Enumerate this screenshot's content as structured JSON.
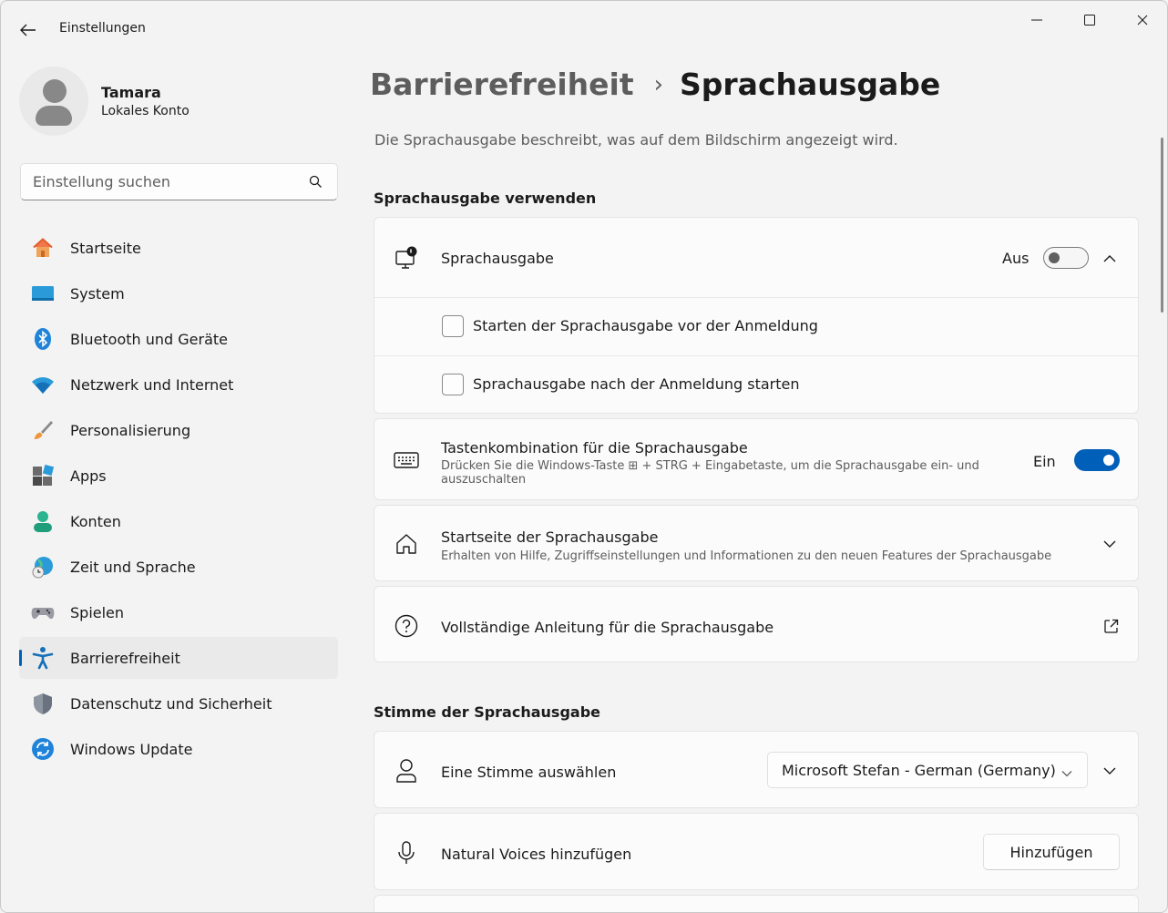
{
  "window": {
    "title": "Einstellungen"
  },
  "profile": {
    "name": "Tamara",
    "account_type": "Lokales Konto"
  },
  "search": {
    "placeholder": "Einstellung suchen"
  },
  "sidebar": {
    "items": [
      {
        "label": "Startseite",
        "icon": "home-icon"
      },
      {
        "label": "System",
        "icon": "system-icon"
      },
      {
        "label": "Bluetooth und Geräte",
        "icon": "bluetooth-icon"
      },
      {
        "label": "Netzwerk und Internet",
        "icon": "wifi-icon"
      },
      {
        "label": "Personalisierung",
        "icon": "brush-icon"
      },
      {
        "label": "Apps",
        "icon": "apps-icon"
      },
      {
        "label": "Konten",
        "icon": "person-icon"
      },
      {
        "label": "Zeit und Sprache",
        "icon": "globe-clock-icon"
      },
      {
        "label": "Spielen",
        "icon": "gamepad-icon"
      },
      {
        "label": "Barrierefreiheit",
        "icon": "accessibility-icon",
        "active": true
      },
      {
        "label": "Datenschutz und Sicherheit",
        "icon": "shield-icon"
      },
      {
        "label": "Windows Update",
        "icon": "update-icon"
      }
    ]
  },
  "breadcrumb": {
    "parent": "Barrierefreiheit",
    "separator": "›",
    "current": "Sprachausgabe"
  },
  "page": {
    "description": "Die Sprachausgabe beschreibt, was auf dem Bildschirm angezeigt wird."
  },
  "section_use": {
    "title": "Sprachausgabe verwenden",
    "narrator": {
      "label": "Sprachausgabe",
      "state": "Aus",
      "on": false
    },
    "options": [
      {
        "label": "Starten der Sprachausgabe vor der Anmeldung",
        "checked": false
      },
      {
        "label": "Sprachausgabe nach der Anmeldung starten",
        "checked": false
      }
    ],
    "shortcut": {
      "label": "Tastenkombination für die Sprachausgabe",
      "description_line1": "Drücken Sie die Windows-Taste ⊞ + STRG + Eingabetaste, um die Sprachausgabe ein- und",
      "description_line2": "auszuschalten",
      "state": "Ein",
      "on": true
    },
    "home": {
      "label": "Startseite der Sprachausgabe",
      "description": "Erhalten von Hilfe, Zugriffseinstellungen und Informationen zu den neuen Features der Sprachausgabe"
    },
    "guide": {
      "label": "Vollständige Anleitung für die Sprachausgabe"
    }
  },
  "section_voice": {
    "title": "Stimme der Sprachausgabe",
    "voice": {
      "label": "Eine Stimme auswählen",
      "selected": "Microsoft Stefan - German (Germany)"
    },
    "natural": {
      "label": "Natural Voices hinzufügen",
      "button": "Hinzufügen"
    }
  },
  "colors": {
    "accent": "#005fb8",
    "background": "#f3f3f3",
    "card": "#fbfbfb"
  }
}
